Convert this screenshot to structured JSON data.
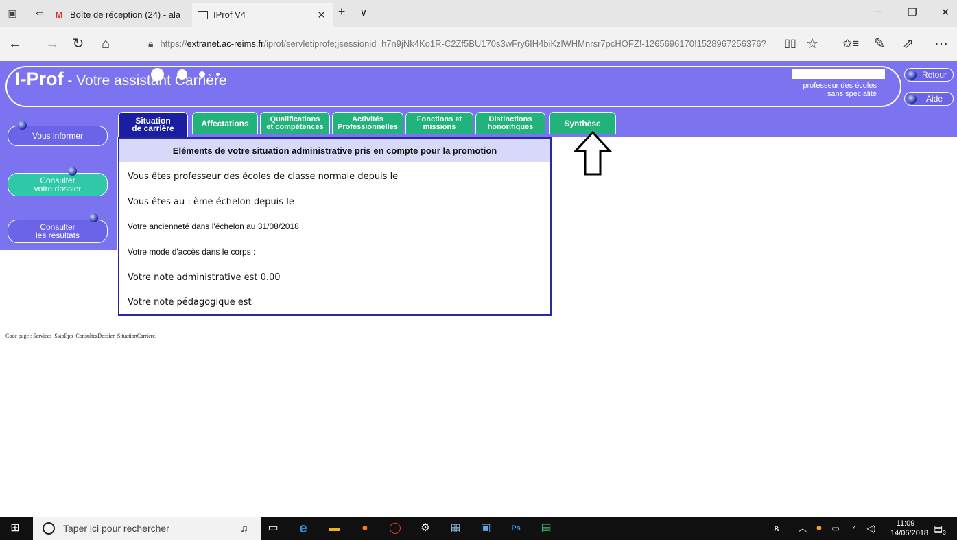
{
  "browser": {
    "tabs": [
      {
        "title": "Boîte de réception (24) - ala",
        "icon": "gmail-icon"
      },
      {
        "title": "IProf V4",
        "icon": "page-icon"
      }
    ],
    "new_tab_label": "+",
    "tab_list_label": "∨",
    "url_prefix": "https://",
    "url_domain": "extranet.ac-reims.fr",
    "url_rest": "/iprof/servletiprofe;jsessionid=h7n9jNk4Ko1R-C2Zf5BU170s3wFry6IH4biKzlWHMnrsr7pcHOFZ!-1265696170!1528967256376?"
  },
  "header": {
    "title_main": "I-Prof",
    "title_sub": " - Votre assistant Carrière",
    "profile_line1": "professeur des écoles",
    "profile_line2": "sans spécialité",
    "retour_label": "Retour",
    "aide_label": "Aide"
  },
  "sidebar": {
    "items": [
      {
        "line1": "Vous informer",
        "line2": ""
      },
      {
        "line1": "Consulter",
        "line2": "votre dossier"
      },
      {
        "line1": "Consulter",
        "line2": "les résultats"
      }
    ]
  },
  "tabs": [
    {
      "line1": "Situation",
      "line2": "de carrière",
      "selected": true
    },
    {
      "line1": "Affectations",
      "line2": ""
    },
    {
      "line1": "Qualifications",
      "line2": "et compétences"
    },
    {
      "line1": "Activités",
      "line2": "Professionnelles"
    },
    {
      "line1": "Fonctions et",
      "line2": "missions"
    },
    {
      "line1": "Distinctions",
      "line2": "honorifiques"
    },
    {
      "line1": "Synthèse",
      "line2": ""
    }
  ],
  "content": {
    "heading": "Eléments de votre situation administrative pris en compte pour la promotion",
    "rows": [
      "Vous êtes professeur des écoles de classe normale depuis le",
      "Vous êtes au :  ème échelon depuis le",
      "Votre ancienneté dans l'échelon au 31/08/2018",
      "Votre mode d'accès dans le corps :",
      "Votre note administrative est 0.00",
      "Votre note pédagogique est"
    ]
  },
  "footer": {
    "code_page": "Code page : Services_SiapEpp_ConsultezDossier_SituationCarriere."
  },
  "taskbar": {
    "search_placeholder": "Taper ici pour rechercher",
    "time": "11:09",
    "date": "14/06/2018",
    "notification_count": "3"
  }
}
